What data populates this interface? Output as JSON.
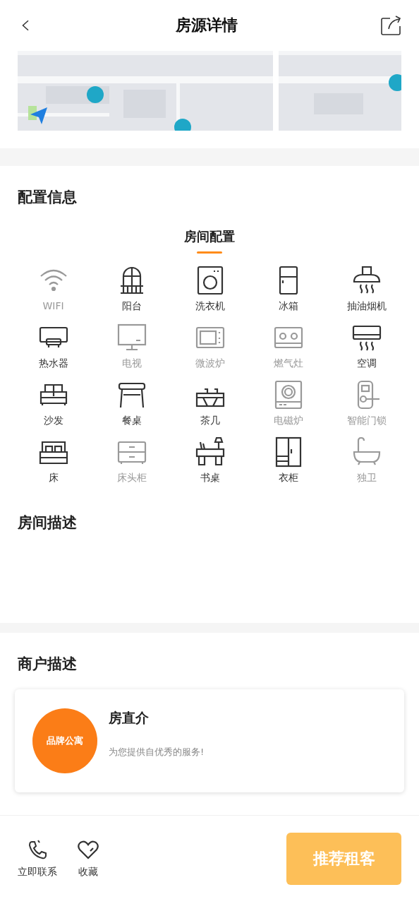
{
  "header": {
    "title": "房源详情"
  },
  "config": {
    "title": "配置信息",
    "tabs": [
      {
        "label": "房间配置",
        "selected": true
      }
    ],
    "items": [
      {
        "kind": "wifi",
        "label": "WIFI",
        "available": false
      },
      {
        "kind": "balcony",
        "label": "阳台",
        "available": true
      },
      {
        "kind": "washer",
        "label": "洗衣机",
        "available": true
      },
      {
        "kind": "fridge",
        "label": "冰箱",
        "available": true
      },
      {
        "kind": "hood",
        "label": "抽油烟机",
        "available": true
      },
      {
        "kind": "heater",
        "label": "热水器",
        "available": true
      },
      {
        "kind": "tv",
        "label": "电视",
        "available": false
      },
      {
        "kind": "microwave",
        "label": "微波炉",
        "available": false
      },
      {
        "kind": "stove",
        "label": "燃气灶",
        "available": false
      },
      {
        "kind": "aircon",
        "label": "空调",
        "available": true
      },
      {
        "kind": "sofa",
        "label": "沙发",
        "available": true
      },
      {
        "kind": "table",
        "label": "餐桌",
        "available": true
      },
      {
        "kind": "teatable",
        "label": "茶几",
        "available": true
      },
      {
        "kind": "induction",
        "label": "电磁炉",
        "available": false
      },
      {
        "kind": "lock",
        "label": "智能门锁",
        "available": false
      },
      {
        "kind": "bed",
        "label": "床",
        "available": true
      },
      {
        "kind": "nightstand",
        "label": "床头柜",
        "available": false
      },
      {
        "kind": "desk",
        "label": "书桌",
        "available": true
      },
      {
        "kind": "wardrobe",
        "label": "衣柜",
        "available": true
      },
      {
        "kind": "bath",
        "label": "独卫",
        "available": false
      }
    ]
  },
  "room_description": {
    "title": "房间描述"
  },
  "merchant": {
    "title": "商户描述",
    "logo_text": "品牌公寓",
    "name": "房直介",
    "slogan": "为您提供自优秀的服务!"
  },
  "bottom_bar": {
    "actions": [
      {
        "kind": "phone",
        "label": "立即联系"
      },
      {
        "kind": "heart",
        "label": "收藏"
      }
    ],
    "primary_button": "推荐租客"
  }
}
